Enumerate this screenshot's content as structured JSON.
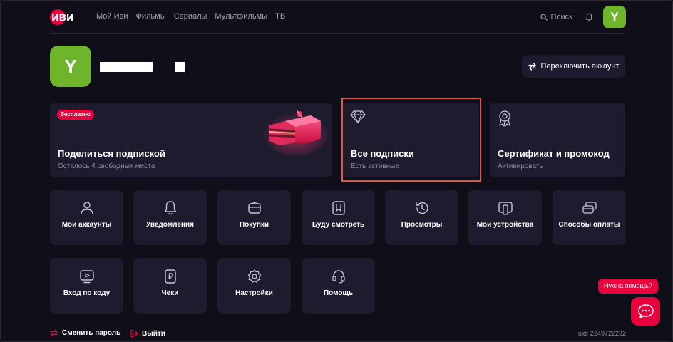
{
  "header": {
    "logo_text": "иви",
    "nav": [
      "Мой Иви",
      "Фильмы",
      "Сериалы",
      "Мультфильмы",
      "ТВ"
    ],
    "search_label": "Поиск",
    "avatar_letter": "Y"
  },
  "profile": {
    "avatar_letter": "Y",
    "switch_account_label": "Переключить аккаунт"
  },
  "cards": {
    "share": {
      "badge": "бесплатно",
      "title": "Поделиться подпиской",
      "subtitle": "Осталось 4 свободных места"
    },
    "subscriptions": {
      "title": "Все подписки",
      "subtitle": "Есть активные",
      "icon": "diamond-icon"
    },
    "certificate": {
      "title": "Сертификат и промокод",
      "subtitle": "Активировать",
      "icon": "award-icon"
    }
  },
  "tiles": [
    {
      "label": "Мои аккаунты",
      "icon": "user-icon"
    },
    {
      "label": "Уведомления",
      "icon": "bell-icon"
    },
    {
      "label": "Покупки",
      "icon": "wallet-icon"
    },
    {
      "label": "Буду смотреть",
      "icon": "bookmark-icon"
    },
    {
      "label": "Просмотры",
      "icon": "history-icon"
    },
    {
      "label": "Мои устройства",
      "icon": "devices-icon"
    },
    {
      "label": "Способы оплаты",
      "icon": "cards-icon"
    },
    {
      "label": "Вход по коду",
      "icon": "tv-play-icon"
    },
    {
      "label": "Чеки",
      "icon": "receipt-icon"
    },
    {
      "label": "Настройки",
      "icon": "gear-icon"
    },
    {
      "label": "Помощь",
      "icon": "headset-icon"
    }
  ],
  "footer": {
    "change_password": "Сменить пароль",
    "logout": "Выйти",
    "uid": "uid: 2249722232"
  },
  "help": {
    "bubble_text": "Нужна помощь?"
  },
  "colors": {
    "background": "#100e19",
    "card": "#1f1b2e",
    "accent": "#ea003d",
    "avatar": "#6fb52c",
    "highlight_border": "#e2553f",
    "muted_text": "#8f8b9f"
  }
}
